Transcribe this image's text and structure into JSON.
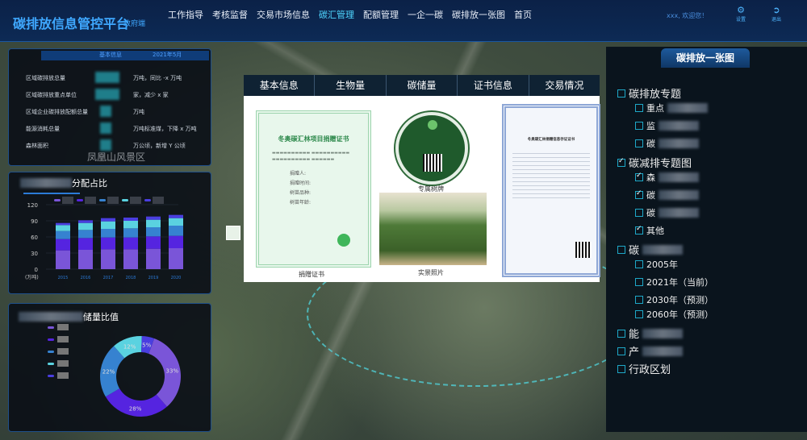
{
  "header": {
    "title": "碳排放信息管控平台",
    "subtitle": "政府端",
    "nav": [
      "工作指导",
      "考核监督",
      "交易市场信息",
      "碳汇管理",
      "配额管理",
      "一企一碳",
      "碳排放一张图",
      "首页"
    ],
    "active_nav": "碳汇管理",
    "welcome": "xxx, 欢迎您！",
    "settings_label": "设置",
    "exit_label": "退出"
  },
  "basic_info": {
    "tab": "基本信息",
    "date": "2021年5月",
    "rows": [
      {
        "label": "区域碳排放总量",
        "unit": "万吨，同比 -x 万吨"
      },
      {
        "label": "区域碳排放重点单位",
        "unit": "家，减少 x 家"
      },
      {
        "label": "区域企业碳排放配额总量",
        "unit": "万吨"
      },
      {
        "label": "能源消耗总量",
        "unit": "万吨标准煤，下降 x 万吨"
      },
      {
        "label": "森林面积",
        "unit": "万公顷，新增 Y 公顷"
      }
    ]
  },
  "map_labels": [
    "凤凰山风景区"
  ],
  "chart_data": [
    {
      "type": "bar",
      "title": "分配占比",
      "ylabel": "(万吨)",
      "ylim": [
        0,
        120
      ],
      "yticks": [
        0,
        30,
        60,
        90,
        120
      ],
      "categories": [
        "2015",
        "2016",
        "2017",
        "2018",
        "2019",
        "2020"
      ],
      "stacked": true,
      "series": [
        {
          "name": "s1",
          "color": "#7a55d8",
          "values": [
            35,
            36,
            37,
            37,
            38,
            39
          ]
        },
        {
          "name": "s2",
          "color": "#5524e0",
          "values": [
            21,
            22,
            22,
            22,
            23,
            23
          ]
        },
        {
          "name": "s3",
          "color": "#3682d0",
          "values": [
            15,
            15,
            16,
            17,
            17,
            19
          ]
        },
        {
          "name": "s4",
          "color": "#5ad2e0",
          "values": [
            11,
            13,
            14,
            14,
            14,
            14
          ]
        },
        {
          "name": "s5",
          "color": "#4a3ee0",
          "values": [
            4,
            5,
            6,
            6,
            6,
            6
          ]
        }
      ]
    },
    {
      "type": "pie",
      "title": "储量比值",
      "donut": true,
      "slices": [
        {
          "value": 33,
          "label": "33%",
          "color": "#7a55d8"
        },
        {
          "value": 28,
          "label": "28%",
          "color": "#5524e0"
        },
        {
          "value": 22,
          "label": "22%",
          "color": "#3682d0"
        },
        {
          "value": 12,
          "label": "12%",
          "color": "#5ad2e0"
        },
        {
          "value": 5,
          "label": "5%",
          "color": "#4a3ee0"
        }
      ]
    }
  ],
  "detail": {
    "tabs": [
      "基本信息",
      "生物量",
      "碳储量",
      "证书信息",
      "交易情况"
    ],
    "cert_title": "冬奥碳汇林项目捐赠证书",
    "cert_fields": [
      "捐赠人:",
      "捐赠时间:",
      "树苗品种:",
      "树苗年龄:"
    ],
    "captions": {
      "cert": "捐赠证书",
      "badge": "专属树牌",
      "photo": "实景照片"
    },
    "cert2_title": "冬奥碳汇林捐赠信息存证证书"
  },
  "right_panel": {
    "title": "碳排放一张图",
    "items": [
      {
        "label": "碳排放专题",
        "level": 1,
        "checked": false
      },
      {
        "label": "重点",
        "level": 2,
        "checked": false,
        "blurred": true
      },
      {
        "label": "监",
        "level": 2,
        "checked": false,
        "blurred": true
      },
      {
        "label": "碳",
        "level": 2,
        "checked": false,
        "blurred": true
      },
      {
        "label": "碳减排专题图",
        "level": 1,
        "checked": true
      },
      {
        "label": "森",
        "level": 2,
        "checked": true,
        "blurred": true
      },
      {
        "label": "碳",
        "level": 2,
        "checked": true,
        "blurred": true
      },
      {
        "label": "碳",
        "level": 2,
        "checked": false,
        "blurred": true
      },
      {
        "label": "其他",
        "level": 2,
        "checked": true
      },
      {
        "label": "碳",
        "level": 1,
        "checked": false,
        "blurred": true
      },
      {
        "label": "2005年",
        "level": 2,
        "checked": false
      },
      {
        "label": "2021年（当前）",
        "level": 2,
        "checked": false
      },
      {
        "label": "2030年（预测）",
        "level": 2,
        "checked": false
      },
      {
        "label": "2060年（预测）",
        "level": 2,
        "checked": false
      },
      {
        "label": "能",
        "level": 1,
        "checked": false,
        "blurred": true
      },
      {
        "label": "产",
        "level": 1,
        "checked": false,
        "blurred": true
      },
      {
        "label": "行政区划",
        "level": 1,
        "checked": false
      }
    ]
  }
}
